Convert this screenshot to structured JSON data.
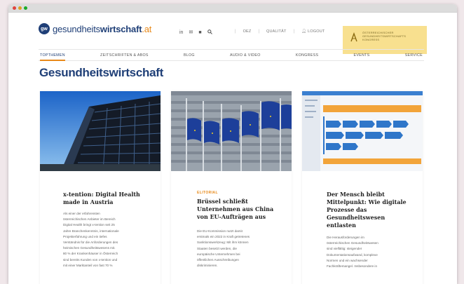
{
  "header": {
    "logo_mark": "gw",
    "logo_prefix": "gesundheits",
    "logo_bold": "wirtschaft",
    "logo_tld": ".at",
    "icons": [
      "linkedin-icon",
      "email-icon",
      "newsletter-icon",
      "search-icon"
    ],
    "links": [
      "OEZ",
      "QUALITÄT",
      "LOGOUT"
    ],
    "banner_lines": [
      "ÖSTERREICHISCHER",
      "GESUNDHEITSWIRTSCHAFTS",
      "KONGRESS"
    ]
  },
  "nav": {
    "items": [
      "TOPTHEMEN",
      "ZEITSCHRIFTEN & ABOS",
      "BLOG",
      "AUDIO & VIDEO",
      "KONGRESS",
      "EVENTS",
      "SERVICE"
    ],
    "active_index": 0
  },
  "page": {
    "title": "Gesundheitswirtschaft"
  },
  "cards": [
    {
      "kicker": "",
      "title_lines": [
        "x-tention: Digital Health",
        "made in Austria"
      ],
      "body_lines": [
        "Als einer der erfahrensten",
        "österreichischen Anbieter im Bereich",
        "Digital Health bringt x-tention seit 25",
        "Jahre Branchenkenntnis, internationale",
        "Projekterfahrung und ein tiefes",
        "Verständnis für die Anforderungen des",
        "heimischen Gesundheitswesens mit.",
        "80 % der Krankenhäuser in Österreich",
        "sind bereits Kunden von x-tention und",
        "mit einer Marktanteil von fast 70 %"
      ]
    },
    {
      "kicker": "ELITORIAL",
      "title_lines": [
        "Brüssel schließt",
        "Unternehmen aus China",
        "von EU-Aufträgen aus"
      ],
      "body_lines": [
        "Die EU-Kommission nutzt damit",
        "erstmals ein 2022 in Kraft getretenes",
        "Sanktionswerkzeug: Mit ihm können",
        "Staaten besetzt werden, die",
        "europäische Unternehmen bei",
        "öffentlichen Ausschreibungen",
        "diskriminieren."
      ]
    },
    {
      "kicker": "",
      "title_lines": [
        "Der Mensch bleibt",
        "Mittelpunkt: Wie digitale",
        "Prozesse das",
        "Gesundheitswesen",
        "entlasten"
      ],
      "body_lines": [
        "Die Herausforderungen im",
        "österreichischen Gesundheitswesen",
        "sind vielfältig: steigender",
        "Dokumentationsaufwand, komplexe",
        "Normen und ein wachsender",
        "Fachkräftemangel. Insbesondere in"
      ]
    }
  ],
  "colors": {
    "brand_navy": "#1f3f77",
    "accent_orange": "#e88a1a",
    "banner_yellow": "#f8e08f"
  }
}
